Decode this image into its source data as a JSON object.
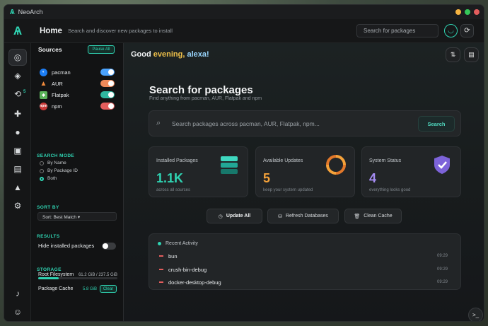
{
  "window": {
    "app_name": "NeoArch",
    "traffic_colors": [
      "#e35d5d",
      "#f5b341",
      "#35c759"
    ]
  },
  "header": {
    "title": "Home",
    "subtitle": "Search and discover new packages to install",
    "search_placeholder": "Search for packages"
  },
  "rail": {
    "updates_badge": "5",
    "items": [
      "discover-icon",
      "layers-icon",
      "updates-icon",
      "puzzle-icon",
      "github-icon",
      "docker-icon",
      "box-icon",
      "arch-icon",
      "settings-icon"
    ],
    "bottom": [
      "bell-icon",
      "user-icon"
    ]
  },
  "sidebar": {
    "sources_title": "Sources",
    "pause_all": "Pause All",
    "sources": [
      {
        "name": "pacman",
        "color": "#1c7ef5",
        "enabled": true,
        "toggle_color": "#4aa3ff"
      },
      {
        "name": "AUR",
        "color": "#f08a3c",
        "enabled": true,
        "toggle_color": "#f08a5a"
      },
      {
        "name": "Flatpak",
        "color": "#5bb45a",
        "enabled": true,
        "toggle_color": "#2fb7a0"
      },
      {
        "name": "npm",
        "color": "#cb3837",
        "enabled": true,
        "toggle_color": "#e35d5d"
      }
    ],
    "search_mode_label": "SEARCH MODE",
    "search_modes": [
      "By Name",
      "By Package ID",
      "Both"
    ],
    "search_mode_selected": "Both",
    "sort_by_label": "SORT BY",
    "sort_value": "Sort: Best Match ▾",
    "results_label": "RESULTS",
    "hide_installed": "Hide installed packages",
    "storage_label": "STORAGE",
    "root_fs_label": "Root Filesystem",
    "root_fs_value": "61.2 GiB / 237.5 GiB",
    "root_fs_fraction": 0.26,
    "cache_label": "Package Cache",
    "cache_value": "5.8 GiB",
    "clear_label": "Clear"
  },
  "main": {
    "greeting_prefix": "Good",
    "greeting_time": "evening,",
    "greeting_name": "alexa!",
    "hero_title": "Search for packages",
    "hero_subtitle": "Find anything from pacman, AUR, Flatpak and npm",
    "search_placeholder": "Search packages across pacman, AUR, Flatpak, npm...",
    "search_button": "Search",
    "cards": [
      {
        "title": "Installed Packages",
        "value": "1.1K",
        "sub": "across all sources",
        "color": "#2fd3b2"
      },
      {
        "title": "Available Updates",
        "value": "5",
        "sub": "keep your system updated",
        "color": "#f5a23a"
      },
      {
        "title": "System Status",
        "value": "4",
        "sub": "everything looks good",
        "color": "#a58cf2"
      }
    ],
    "actions": [
      "Update All",
      "Refresh Databases",
      "Clean Cache"
    ],
    "recent_title": "Recent Activity",
    "recent": [
      {
        "name": "bun",
        "time": "09:29"
      },
      {
        "name": "crush-bin-debug",
        "time": "09:29"
      },
      {
        "name": "docker-desktop-debug",
        "time": "09:29"
      }
    ]
  }
}
